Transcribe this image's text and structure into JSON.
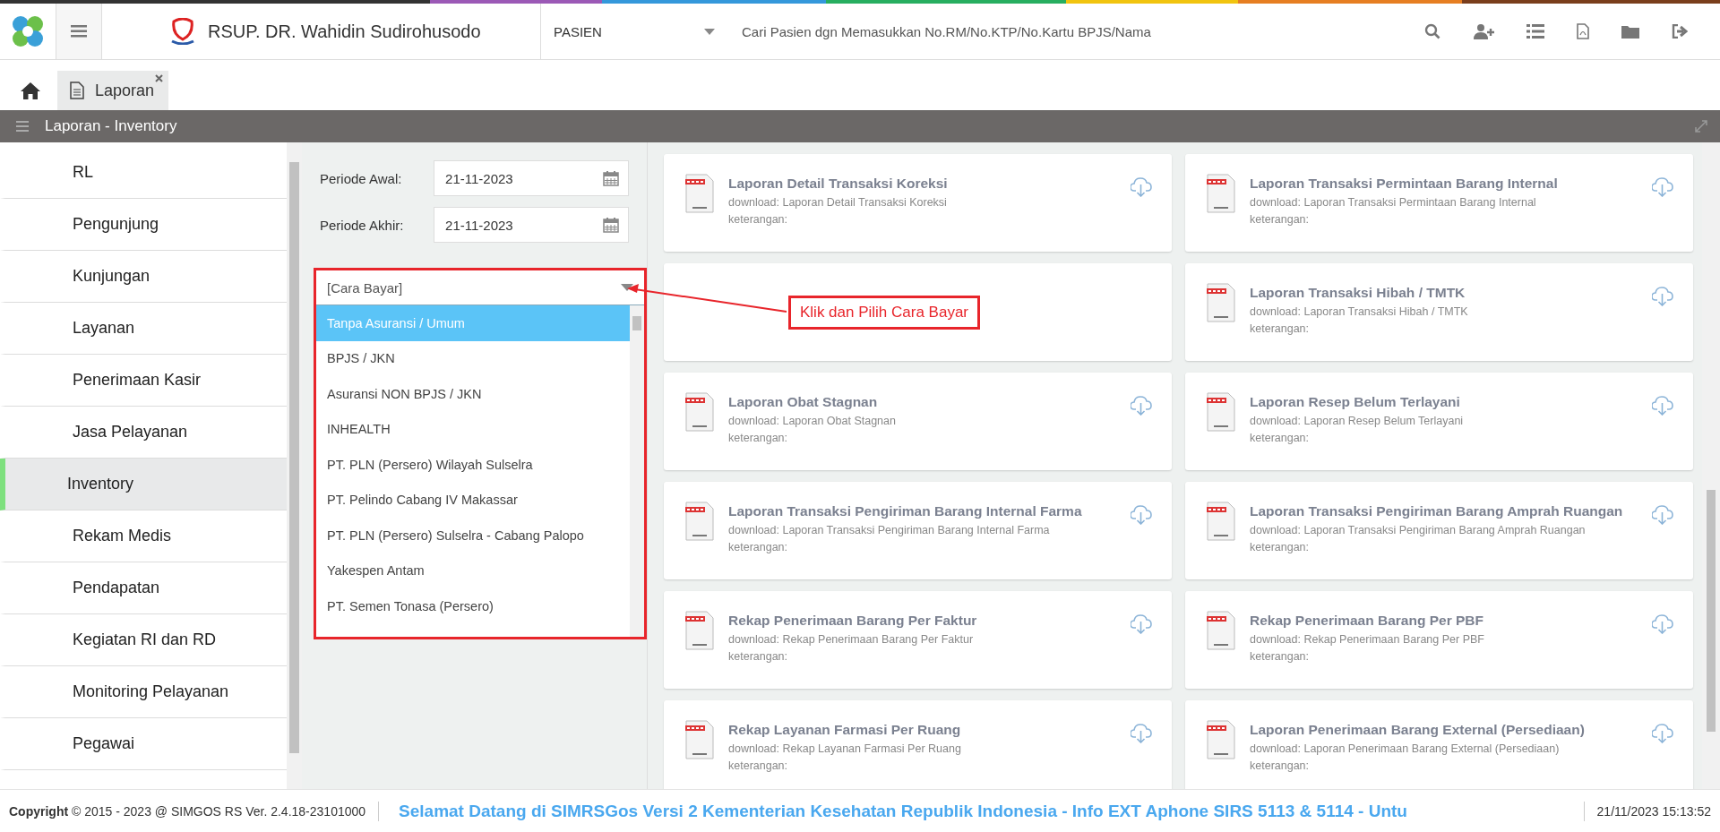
{
  "header": {
    "brand": "RSUP. DR. Wahidin Sudirohusodo",
    "module_select": {
      "value": "PASIEN"
    },
    "search": {
      "placeholder": "Cari Pasien dgn Memasukkan No.RM/No.KTP/No.Kartu BPJS/Nama"
    }
  },
  "tabs": [
    {
      "label": "Laporan",
      "selected": true
    }
  ],
  "panel_title": "Laporan - Inventory",
  "sidebar": {
    "items": [
      {
        "label": "RL",
        "selected": false
      },
      {
        "label": "Pengunjung",
        "selected": false
      },
      {
        "label": "Kunjungan",
        "selected": false
      },
      {
        "label": "Layanan",
        "selected": false
      },
      {
        "label": "Penerimaan Kasir",
        "selected": false
      },
      {
        "label": "Jasa Pelayanan",
        "selected": false
      },
      {
        "label": "Inventory",
        "selected": true
      },
      {
        "label": "Rekam Medis",
        "selected": false
      },
      {
        "label": "Pendapatan",
        "selected": false
      },
      {
        "label": "Kegiatan RI dan RD",
        "selected": false
      },
      {
        "label": "Monitoring Pelayanan",
        "selected": false
      },
      {
        "label": "Pegawai",
        "selected": false
      }
    ]
  },
  "filters": [
    {
      "label": "Periode Awal:",
      "value": "21-11-2023"
    },
    {
      "label": "Periode Akhir:",
      "value": "21-11-2023"
    }
  ],
  "cara_bayar": {
    "placeholder": "[Cara Bayar]",
    "expanded": true,
    "options": [
      {
        "label": "Tanpa Asuransi / Umum",
        "selected": true
      },
      {
        "label": "BPJS / JKN",
        "selected": false
      },
      {
        "label": "Asuransi NON BPJS / JKN",
        "selected": false
      },
      {
        "label": "INHEALTH",
        "selected": false
      },
      {
        "label": "PT. PLN (Persero) Wilayah Sulselra",
        "selected": false
      },
      {
        "label": "PT. Pelindo Cabang IV Makassar",
        "selected": false
      },
      {
        "label": "PT. PLN (Persero) Sulselra - Cabang Palopo",
        "selected": false
      },
      {
        "label": "Yakespen Antam",
        "selected": false
      },
      {
        "label": "PT. Semen Tonasa (Persero)",
        "selected": false
      }
    ]
  },
  "annotation": {
    "text": "Klik dan Pilih Cara Bayar"
  },
  "reports": [
    {
      "kind": "report",
      "title": "Laporan Detail Transaksi Koreksi",
      "download": "download: Laporan Detail Transaksi Koreksi",
      "note": "keterangan:"
    },
    {
      "kind": "report",
      "title": "Laporan Transaksi Permintaan Barang Internal",
      "download": "download: Laporan Transaksi Permintaan Barang Internal",
      "note": "keterangan:"
    },
    {
      "kind": "empty"
    },
    {
      "kind": "report",
      "title": "Laporan Transaksi Hibah / TMTK",
      "download": "download: Laporan Transaksi Hibah / TMTK",
      "note": "keterangan:"
    },
    {
      "kind": "report",
      "title": "Laporan Obat Stagnan",
      "download": "download: Laporan Obat Stagnan",
      "note": "keterangan:"
    },
    {
      "kind": "report",
      "title": "Laporan Resep Belum Terlayani",
      "download": "download: Laporan Resep Belum Terlayani",
      "note": "keterangan:"
    },
    {
      "kind": "report",
      "title": "Laporan Transaksi Pengiriman Barang Internal Farma",
      "download": "download: Laporan Transaksi Pengiriman Barang Internal Farma",
      "note": "keterangan:"
    },
    {
      "kind": "report",
      "title": "Laporan Transaksi Pengiriman Barang Amprah Ruangan",
      "download": "download: Laporan Transaksi Pengiriman Barang Amprah Ruangan",
      "note": "keterangan:"
    },
    {
      "kind": "report",
      "title": "Rekap Penerimaan Barang Per Faktur",
      "download": "download: Rekap Penerimaan Barang Per Faktur",
      "note": "keterangan:"
    },
    {
      "kind": "report",
      "title": "Rekap Penerimaan Barang Per PBF",
      "download": "download: Rekap Penerimaan Barang Per PBF",
      "note": "keterangan:"
    },
    {
      "kind": "report",
      "title": "Rekap Layanan Farmasi Per Ruang",
      "download": "download: Rekap Layanan Farmasi Per Ruang",
      "note": "keterangan:"
    },
    {
      "kind": "report",
      "title": "Laporan Penerimaan Barang External (Persediaan)",
      "download": "download: Laporan Penerimaan Barang External (Persediaan)",
      "note": "keterangan:"
    }
  ],
  "footer": {
    "copyright": "**Copyright** © 2015 - 2023 @ SIMGOS RS Ver. 2.4.18-23101000",
    "marquee": "Selamat Datang di SIMRSGos Versi 2 Kementerian Kesehatan Republik Indonesia - Info EXT Aphone SIRS 5113 & 5114 - Untu",
    "datetime": "21/11/2023 15:13:52"
  }
}
